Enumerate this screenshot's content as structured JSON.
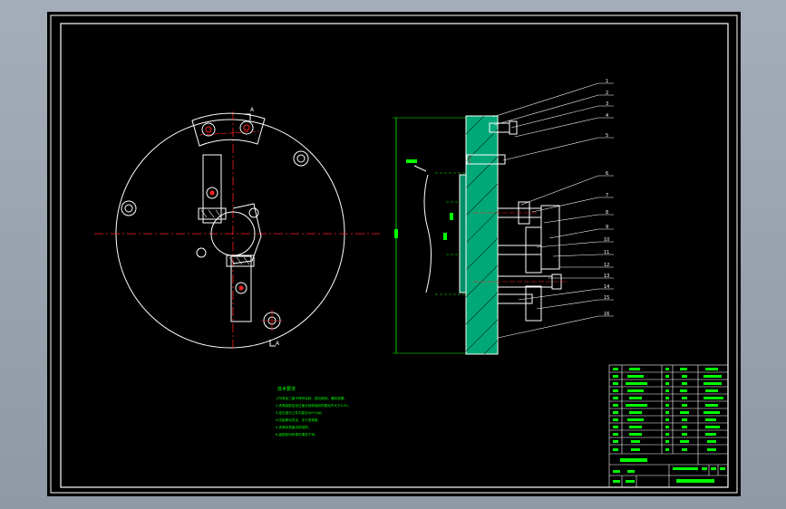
{
  "drawing": {
    "colors": {
      "background": "#000000",
      "frame": "#ffffff",
      "centerline": "#ff2020",
      "part_outline": "#ffffff",
      "section_fill": "#00a878",
      "dimension": "#00ff00",
      "leader": "#ffffff",
      "notes": "#00ff00",
      "title_text": "#ffffff"
    },
    "section_labels": {
      "left_top": "A",
      "left_bottom": "A"
    },
    "balloon_count": 16,
    "notes": {
      "heading": "技术要求",
      "items": [
        "1.所有加工面不得有毛刺，锐边倒钝，清除铁屑。",
        "2.夹具装配后定位面对回转轴线的跳动不大于0.02。",
        "3.定位销与工件孔配合为H7/g6。",
        "4.压板移动灵活，无卡滞现象。",
        "5.夹具体表面涂防锈漆。",
        "6.装配前所有零件清洗干净。"
      ]
    },
    "title_block": {
      "bom_rows": 12,
      "school": "",
      "drawing_title": ""
    }
  }
}
